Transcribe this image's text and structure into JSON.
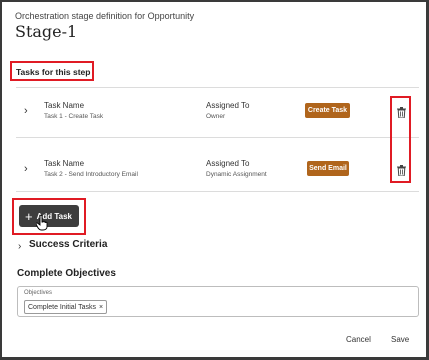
{
  "header": {
    "subtitle": "Orchestration stage definition for Opportunity",
    "title": "Stage-1"
  },
  "tasks_section": {
    "title": "Tasks for this step",
    "rows": [
      {
        "name_label": "Task Name",
        "name_value": "Task 1 - Create Task",
        "assigned_label": "Assigned To",
        "assigned_value": "Owner",
        "button": "Create Task"
      },
      {
        "name_label": "Task Name",
        "name_value": "Task 2 - Send Introductory Email",
        "assigned_label": "Assigned To",
        "assigned_value": "Dynamic Assignment",
        "button": "Send Email"
      }
    ],
    "add_button": "Add Task"
  },
  "success_criteria": {
    "label": "Success Criteria"
  },
  "objectives": {
    "title": "Complete Objectives",
    "field_label": "Objectives",
    "chip": "Complete Initial Tasks"
  },
  "footer": {
    "cancel": "Cancel",
    "save": "Save"
  },
  "colors": {
    "task_button": "#b0651c",
    "highlight": "#e01b24",
    "add_button": "#3d3d3d"
  }
}
